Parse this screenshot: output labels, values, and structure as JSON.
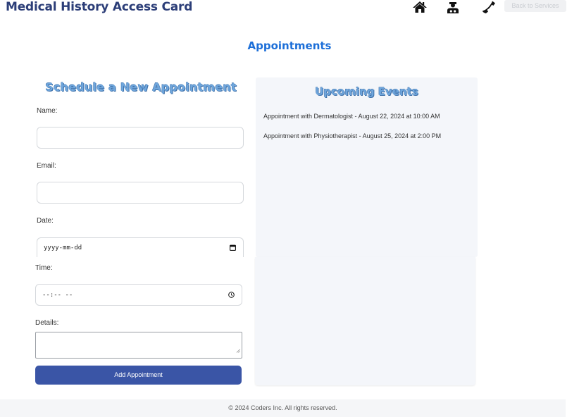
{
  "header": {
    "title": "Medical History Access Card",
    "nav_icons": [
      "home-icon",
      "doctor-icon",
      "phone-icon"
    ],
    "back_label": "Back to Services"
  },
  "page": {
    "title": "Appointments"
  },
  "form": {
    "title": "Schedule a New Appointment",
    "name_label": "Name:",
    "name_value": "",
    "email_label": "Email:",
    "email_value": "",
    "date_label": "Date:",
    "date_value": "yyyy-mm-dd",
    "time_label": "Time:",
    "time_value": "--:-- --",
    "details_label": "Details:",
    "details_value": "",
    "submit_label": "Add Appointment"
  },
  "events": {
    "title": "Upcoming Events",
    "items": [
      "Appointment with Dermatologist - August 22, 2024 at 10:00 AM",
      "Appointment with Physiotherapist - August 25, 2024 at 2:00 PM"
    ]
  },
  "footer": {
    "text": "© 2024 Coders Inc. All rights reserved."
  },
  "colors": {
    "brand": "#2c3e78",
    "accent": "#1d6fd8",
    "button": "#3a55a6",
    "panel": "#f4f6fa"
  }
}
